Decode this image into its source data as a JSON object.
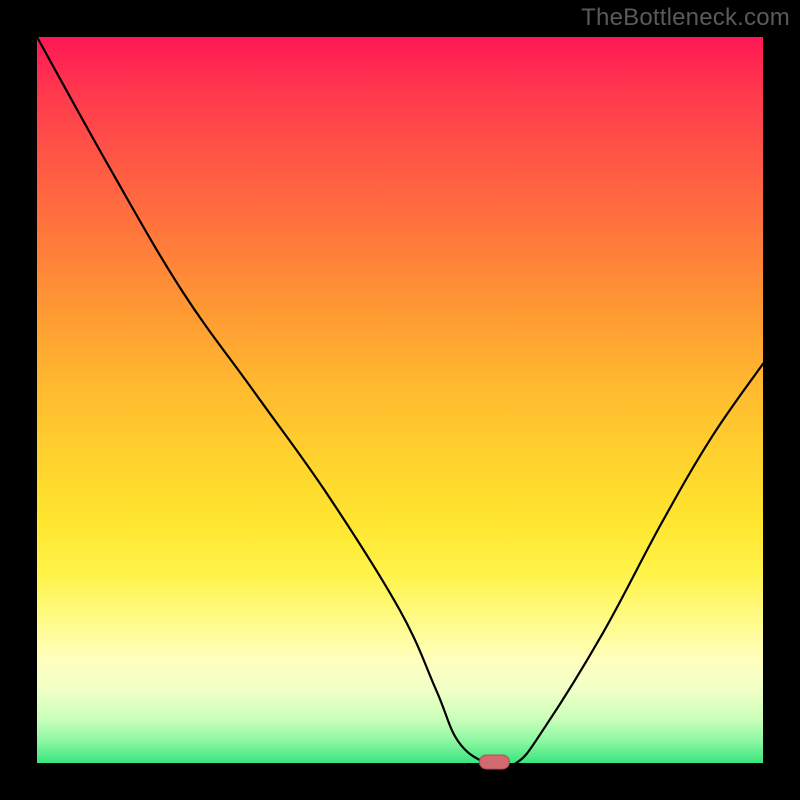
{
  "watermark": "TheBottleneck.com",
  "chart_data": {
    "type": "line",
    "title": "",
    "xlabel": "",
    "ylabel": "",
    "xlim": [
      0,
      100
    ],
    "ylim": [
      0,
      100
    ],
    "grid": false,
    "legend": false,
    "series": [
      {
        "name": "bottleneck-percentage",
        "x": [
          0,
          10,
          20,
          30,
          40,
          50,
          55,
          58,
          62,
          66,
          70,
          78,
          86,
          93,
          100
        ],
        "values": [
          100,
          82,
          65,
          51,
          37,
          21,
          10,
          3,
          0,
          0,
          5,
          18,
          33,
          45,
          55
        ]
      }
    ],
    "marker": {
      "x": 63,
      "y": 0,
      "label": "optimal-point"
    }
  },
  "colors": {
    "gradient_top": "#ff1856",
    "gradient_mid": "#ffd22e",
    "gradient_bottom": "#39e57f",
    "curve": "#000000",
    "marker_fill": "#d06a6f",
    "frame": "#000000"
  }
}
